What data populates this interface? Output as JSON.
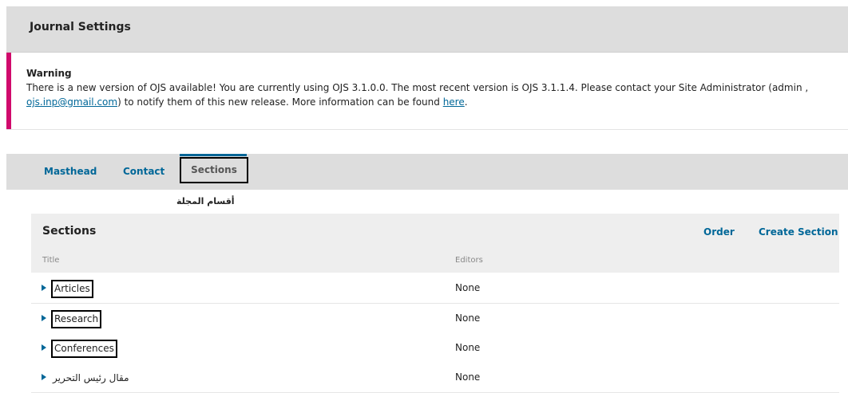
{
  "header": {
    "title": "Journal Settings"
  },
  "warning": {
    "title": "Warning",
    "text_part1": "There is a new version of OJS available! You are currently using OJS 3.1.0.0. The most recent version is OJS 3.1.1.4. Please contact your Site Administrator (admin , ",
    "email_link": "ojs.inp@gmail.com",
    "text_part2": ") to notify them of this new release. More information can be found ",
    "here_link": "here",
    "text_part3": ".",
    "accent_color": "#d00a6c"
  },
  "tabs": [
    {
      "label": "Masthead"
    },
    {
      "label": "Contact"
    },
    {
      "label": "Sections"
    }
  ],
  "annotation": "أقسام المجلة",
  "grid": {
    "title": "Sections",
    "actions": {
      "order": "Order",
      "create": "Create Section"
    },
    "columns": {
      "title": "Title",
      "editors": "Editors"
    },
    "rows": [
      {
        "title": "Articles",
        "editors": "None"
      },
      {
        "title": "Research",
        "editors": "None"
      },
      {
        "title": "Conferences",
        "editors": "None"
      },
      {
        "title": "مقال رئيس التحرير",
        "editors": "None"
      }
    ]
  },
  "colors": {
    "link": "#006798",
    "header_bg": "#dddddd"
  }
}
